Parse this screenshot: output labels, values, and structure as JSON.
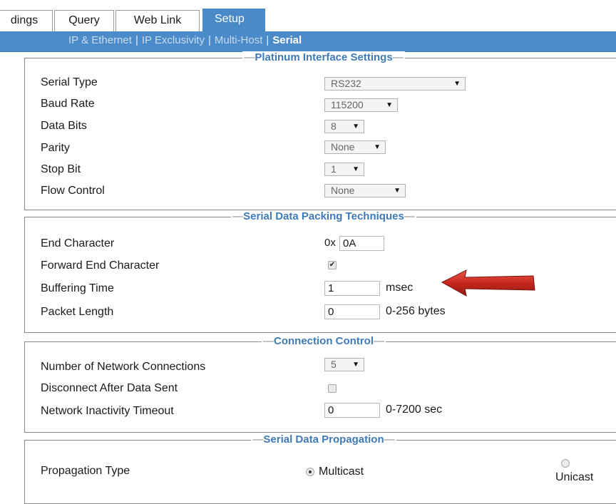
{
  "tabs": [
    {
      "label": "dings"
    },
    {
      "label": "Query"
    },
    {
      "label": "Web Link"
    },
    {
      "label": "Setup"
    }
  ],
  "subnav": {
    "items": [
      "IP & Ethernet",
      "IP Exclusivity",
      "Multi-Host",
      "Serial"
    ],
    "separator": "|",
    "current": "Serial"
  },
  "platinum": {
    "legend": "Platinum Interface Settings",
    "serial_type": {
      "label": "Serial Type",
      "value": "RS232"
    },
    "baud_rate": {
      "label": "Baud Rate",
      "value": "115200"
    },
    "data_bits": {
      "label": "Data Bits",
      "value": "8"
    },
    "parity": {
      "label": "Parity",
      "value": "None"
    },
    "stop_bit": {
      "label": "Stop Bit",
      "value": "1"
    },
    "flow_control": {
      "label": "Flow Control",
      "value": "None"
    }
  },
  "packing": {
    "legend": "Serial Data Packing Techniques",
    "end_character": {
      "label": "End Character",
      "prefix": "0x",
      "value": "0A"
    },
    "forward_end": {
      "label": "Forward End Character",
      "checked": true
    },
    "buffering_time": {
      "label": "Buffering Time",
      "value": "1",
      "unit": "msec"
    },
    "packet_length": {
      "label": "Packet Length",
      "value": "0",
      "unit": "0-256 bytes"
    }
  },
  "connection": {
    "legend": "Connection Control",
    "network_connections": {
      "label": "Number of Network Connections",
      "value": "5"
    },
    "disconnect_after": {
      "label": "Disconnect After Data Sent",
      "checked": false
    },
    "inactivity_timeout": {
      "label": "Network Inactivity Timeout",
      "value": "0",
      "unit": "0-7200 sec"
    }
  },
  "propagation": {
    "legend": "Serial Data Propagation",
    "type_label": "Propagation Type",
    "options": [
      {
        "label": "Multicast",
        "selected": true
      },
      {
        "label": "Unicast",
        "selected": false
      }
    ]
  },
  "colors": {
    "accent": "#4a8ac8",
    "legend_text": "#3f7ab8",
    "arrow_red": "#c8271c"
  }
}
